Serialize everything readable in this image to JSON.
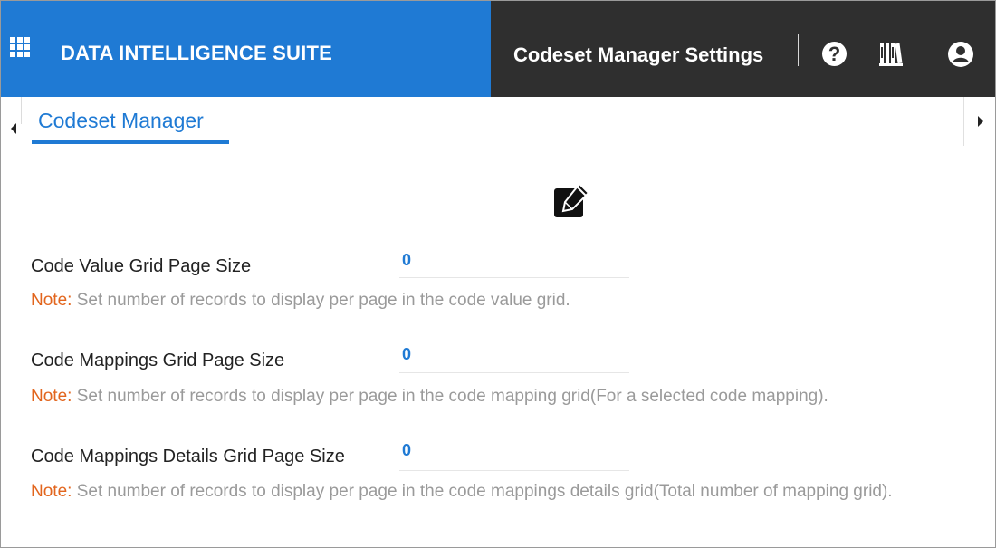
{
  "header": {
    "brand_title": "DATA INTELLIGENCE SUITE",
    "page_title": "Codeset Manager Settings",
    "icons": [
      "apps-grid-icon",
      "help-icon",
      "library-icon",
      "user-icon"
    ],
    "help_glyph": "?"
  },
  "tabs": [
    {
      "label": "Codeset Manager",
      "active": true
    }
  ],
  "settings": [
    {
      "label": "Code Value Grid Page Size",
      "value": "0",
      "note_key": "Note:",
      "note_text": " Set number of records to display per page in the code value grid."
    },
    {
      "label": "Code Mappings Grid Page Size",
      "value": "0",
      "note_key": "Note:",
      "note_text": " Set number of records to display per page in the code mapping grid(For a selected code mapping)."
    },
    {
      "label": "Code Mappings Details Grid Page Size",
      "value": "0",
      "note_key": "Note:",
      "note_text": " Set number of records to display per page in the code mappings details grid(Total number of mapping grid)."
    }
  ],
  "colors": {
    "brand_blue": "#1f7ad4",
    "header_dark": "#2f2f2f",
    "note_key": "#e2651d",
    "note_text": "#9a9a9a"
  }
}
